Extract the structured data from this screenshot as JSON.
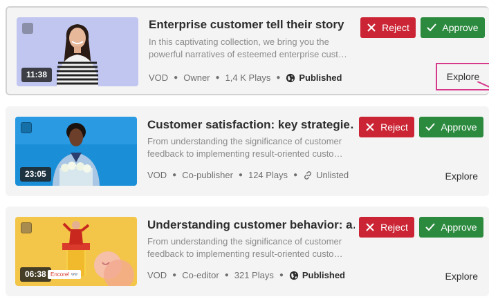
{
  "colors": {
    "reject": "#cb2535",
    "approve": "#2b8a3e",
    "highlight": "#d6398b",
    "card_bg": "#f4f4f4"
  },
  "cards": [
    {
      "title": "Enterprise customer tell their story",
      "description_lines": [
        "In this captivating collection, we bring you the",
        "powerful narratives of esteemed enterprise cust…"
      ],
      "duration": "11:38",
      "type": "VOD",
      "role": "Owner",
      "plays": "1,4 K Plays",
      "status": "Published",
      "status_icon": "globe-icon",
      "reject_label": "Reject",
      "approve_label": "Approve",
      "explore_label": "Explore",
      "selected": true
    },
    {
      "title": "Customer satisfaction: key strategie…",
      "description_lines": [
        "From understanding the significance of customer",
        "feedback to implementing result-oriented custo…"
      ],
      "duration": "23:05",
      "type": "VOD",
      "role": "Co-publisher",
      "plays": "124 Plays",
      "status": "Unlisted",
      "status_icon": "link-icon",
      "reject_label": "Reject",
      "approve_label": "Approve",
      "explore_label": "Explore",
      "selected": false
    },
    {
      "title": "Understanding customer behavior: a…",
      "description_lines": [
        "From understanding the significance of customer",
        "feedback to implementing result-oriented custo…"
      ],
      "duration": "06:38",
      "type": "VOD",
      "role": "Co-editor",
      "plays": "321 Plays",
      "status": "Published",
      "status_icon": "globe-icon",
      "reject_label": "Reject",
      "approve_label": "Approve",
      "explore_label": "Explore",
      "selected": false,
      "thumb_caption": "Encore! 👓"
    }
  ]
}
